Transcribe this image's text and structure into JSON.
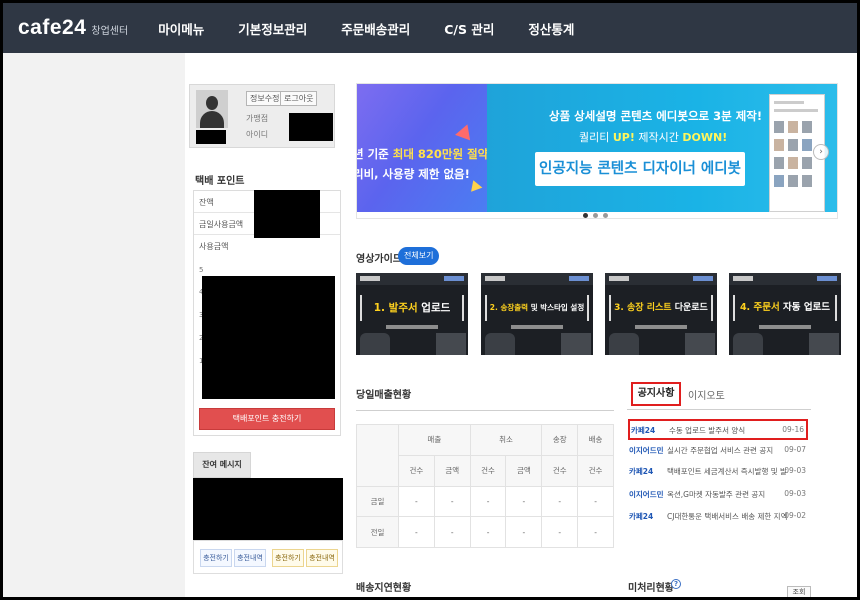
{
  "nav": {
    "logo": "cafe24",
    "logo_sub": "창업센터",
    "items": [
      {
        "label": "마이메뉴"
      },
      {
        "label": "기본정보관리"
      },
      {
        "label": "주문배송관리"
      },
      {
        "label": "C/S 관리"
      },
      {
        "label": "정산통계"
      }
    ]
  },
  "profile": {
    "edit_button": "정보수정",
    "logout_button": "로그아웃",
    "merchant_label": "가맹점",
    "id_label": "아이디"
  },
  "points": {
    "title": "택배 포인트",
    "balance_label": "잔액",
    "today_label": "금일사용금액",
    "usage_label": "사용금액",
    "y_ticks": [
      "5",
      "4",
      "3",
      "2",
      "1"
    ],
    "charge_button": "택배포인트 충전하기"
  },
  "message": {
    "tab": "잔여 메시지",
    "buttons": [
      "충전하기",
      "충전내역",
      "충전하기",
      "충전내역"
    ]
  },
  "banner": {
    "left_line1_prefix": "년 기준",
    "left_line1_highlight": "최대 820만원 절약!",
    "left_line2": "리비, 사용량 제한 없음!",
    "right_line1": "상품 상세설명 콘텐츠 에디봇으로 3분 제작!",
    "right_line2_a": "퀄리티",
    "right_line2_b": "UP!",
    "right_line2_c": "제작시간",
    "right_line2_d": "DOWN!",
    "right_pill": "인공지능 콘텐츠 디자이너 에디봇"
  },
  "video": {
    "title": "영상가이드",
    "view_all": "전체보기",
    "items": [
      {
        "num": "1.",
        "a": "발주서",
        "b": "업로드"
      },
      {
        "num": "2.",
        "a": "송장출력",
        "b": "및 박스타입 설정"
      },
      {
        "num": "3.",
        "a": "송장 리스트",
        "b": "다운로드"
      },
      {
        "num": "4.",
        "a": "주문서",
        "b": "자동 업로드"
      }
    ]
  },
  "sales": {
    "title": "당일매출현황",
    "groups": [
      "매출",
      "취소",
      "송장",
      "배송"
    ],
    "subheaders": [
      "건수",
      "금액",
      "건수",
      "금액",
      "건수",
      "건수"
    ],
    "rows": [
      {
        "label": "금일",
        "values": [
          "-",
          "-",
          "-",
          "-",
          "-",
          "-"
        ]
      },
      {
        "label": "전일",
        "values": [
          "-",
          "-",
          "-",
          "-",
          "-",
          "-"
        ]
      }
    ]
  },
  "delay": {
    "title": "배송지연현황"
  },
  "notices": {
    "tab_active": "공지사항",
    "tab_other": "이지오토",
    "items": [
      {
        "source": "카페24",
        "title": "수동 업로드 발주서 양식",
        "date": "09-16"
      },
      {
        "source": "이지어드민",
        "title": "실시간 주문협업 서비스 관련 공지",
        "date": "09-07"
      },
      {
        "source": "카페24",
        "title": "택배포인트 세금계산서 즉시발행 및 발행",
        "date": "09-03"
      },
      {
        "source": "이지어드민",
        "title": "옥션,G마켓 자동발주 관련 공지",
        "date": "09-03"
      },
      {
        "source": "카페24",
        "title": "CJ대한통운 택배서비스 배송 제한 지역",
        "date": "09-02"
      }
    ]
  },
  "pending": {
    "title": "미처리현황",
    "lookup_button": "조회"
  }
}
